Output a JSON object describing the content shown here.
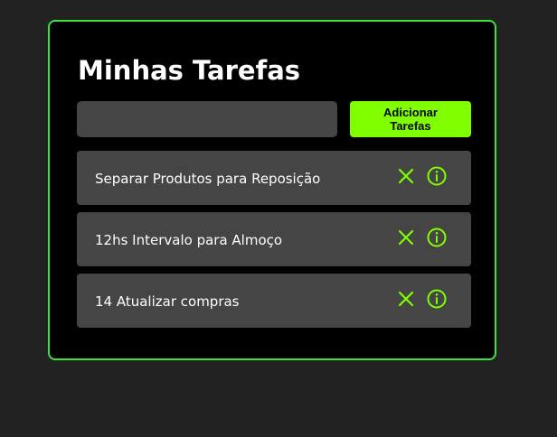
{
  "app": {
    "title": "Minhas Tarefas"
  },
  "form": {
    "input_value": "",
    "input_placeholder": "",
    "add_button_label": "Adicionar Tarefas"
  },
  "tasks": [
    {
      "text": "Separar Produtos para Reposição",
      "icons": [
        "close-icon",
        "info-icon"
      ]
    },
    {
      "text": "12hs Intervalo para Almoço",
      "icons": [
        "close-icon",
        "info-icon"
      ]
    },
    {
      "text": "14 Atualizar compras",
      "icons": [
        "close-icon",
        "info-icon"
      ]
    }
  ],
  "colors": {
    "page_background": "#222222",
    "card_background": "#000000",
    "card_border": "#3de33d",
    "accent": "#7fff00",
    "item_background": "#454545",
    "text": "#ffffff"
  }
}
